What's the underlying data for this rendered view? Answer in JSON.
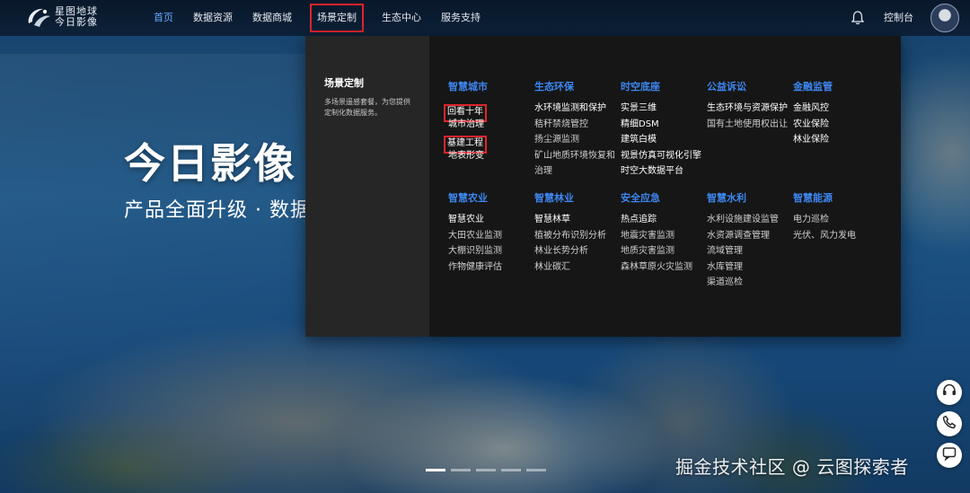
{
  "brand": {
    "line1": "星图地球",
    "line2": "今日影像"
  },
  "nav": {
    "items": [
      {
        "label": "首页",
        "name": "nav-home",
        "active": true
      },
      {
        "label": "数据资源",
        "name": "nav-data-resources"
      },
      {
        "label": "数据商城",
        "name": "nav-data-mall"
      },
      {
        "label": "场景定制",
        "name": "nav-scene-custom",
        "boxed": true
      },
      {
        "label": "生态中心",
        "name": "nav-ecology-center"
      },
      {
        "label": "服务支持",
        "name": "nav-service-support"
      }
    ],
    "console": "控制台"
  },
  "hero": {
    "title": "今日影像",
    "subtitle": "产品全面升级 · 数据全"
  },
  "panel": {
    "side_title": "场景定制",
    "side_desc": "多场景遥感套餐，为您提供定制化数据服务。",
    "columns": [
      {
        "title": "智慧城市",
        "items": [
          {
            "label": "回看十年",
            "boxed": true
          },
          {
            "label": "城市治理",
            "hl": true
          },
          {
            "label": "基建工程",
            "boxed": true
          },
          {
            "label": "地表形变",
            "hl": true
          }
        ]
      },
      {
        "title": "生态环保",
        "items": [
          {
            "label": "水环境监测和保护",
            "hl": true
          },
          {
            "label": "秸秆禁烧管控"
          },
          {
            "label": "扬尘源监测"
          },
          {
            "label": "矿山地质环境恢复和治理",
            "wrap": true
          }
        ]
      },
      {
        "title": "时空底座",
        "items": [
          {
            "label": "实景三维",
            "hl": true
          },
          {
            "label": "精细DSM",
            "hl": true
          },
          {
            "label": "建筑白模",
            "hl": true
          },
          {
            "label": "视景仿真可视化引擎",
            "hl": true
          },
          {
            "label": "时空大数据平台",
            "hl": true
          }
        ]
      },
      {
        "title": "公益诉讼",
        "items": [
          {
            "label": "生态环境与资源保护",
            "hl": true
          },
          {
            "label": "国有土地使用权出让"
          }
        ]
      },
      {
        "title": "金融监管",
        "items": [
          {
            "label": "金融风控",
            "hl": true
          },
          {
            "label": "农业保险",
            "hl": true
          },
          {
            "label": "林业保险",
            "hl": true
          }
        ]
      },
      {
        "title": "智慧农业",
        "items": [
          {
            "label": "智慧农业",
            "hl": true
          },
          {
            "label": "大田农业监测"
          },
          {
            "label": "大棚识别监测"
          },
          {
            "label": "作物健康评估"
          }
        ]
      },
      {
        "title": "智慧林业",
        "items": [
          {
            "label": "智慧林草",
            "hl": true
          },
          {
            "label": "植被分布识别分析"
          },
          {
            "label": "林业长势分析"
          },
          {
            "label": "林业碳汇"
          }
        ]
      },
      {
        "title": "安全应急",
        "items": [
          {
            "label": "热点追踪",
            "hl": true
          },
          {
            "label": "地震灾害监测"
          },
          {
            "label": "地质灾害监测"
          },
          {
            "label": "森林草原火灾监测"
          }
        ]
      },
      {
        "title": "智慧水利",
        "items": [
          {
            "label": "水利设施建设监管"
          },
          {
            "label": "水资源调查管理"
          },
          {
            "label": "流域管理"
          },
          {
            "label": "水库管理"
          },
          {
            "label": "渠道巡检"
          }
        ]
      },
      {
        "title": "智慧能源",
        "items": [
          {
            "label": "电力巡检"
          },
          {
            "label": "光伏、风力发电"
          }
        ]
      }
    ]
  },
  "float_buttons": [
    "headset-icon",
    "phone-icon",
    "chat-icon"
  ],
  "watermark": "掘金技术社区 @ 云图探索者",
  "colors": {
    "accent": "#3d86f0",
    "highlight_box": "#e0242c",
    "panel_bg": "#161616",
    "panel_side_bg": "#262626"
  }
}
